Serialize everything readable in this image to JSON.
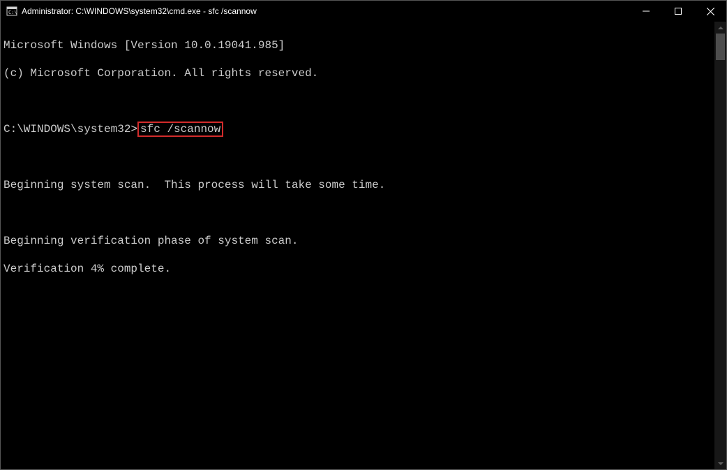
{
  "titlebar": {
    "text": "Administrator: C:\\WINDOWS\\system32\\cmd.exe - sfc  /scannow"
  },
  "terminal": {
    "line1": "Microsoft Windows [Version 10.0.19041.985]",
    "line2": "(c) Microsoft Corporation. All rights reserved.",
    "blank1": " ",
    "prompt": "C:\\WINDOWS\\system32>",
    "command": "sfc /scannow",
    "blank2": " ",
    "line3": "Beginning system scan.  This process will take some time.",
    "blank3": " ",
    "line4": "Beginning verification phase of system scan.",
    "line5": "Verification 4% complete."
  }
}
